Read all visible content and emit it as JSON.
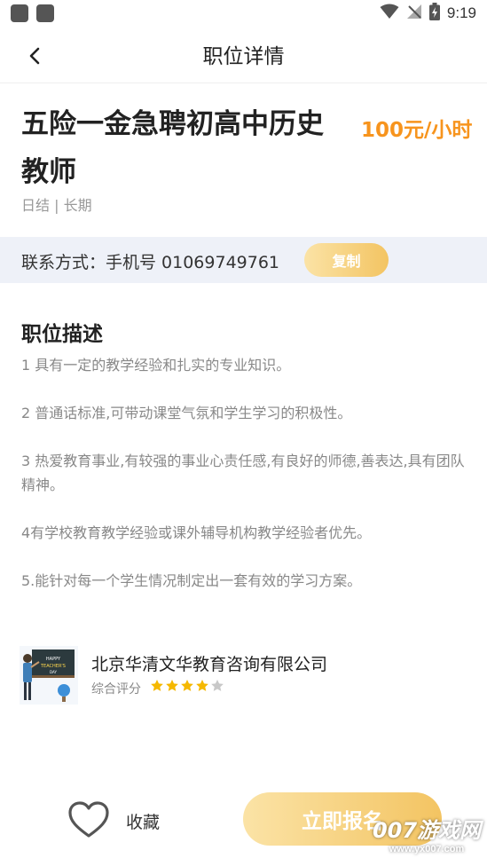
{
  "status_bar": {
    "time": "9:19",
    "icons": [
      "app-notification-icon",
      "app-notification-icon",
      "wifi-icon",
      "no-signal-icon",
      "battery-charging-icon"
    ]
  },
  "nav": {
    "title": "职位详情",
    "back_icon": "chevron-left-icon"
  },
  "job": {
    "title": "五险一金急聘初高中历史教师",
    "salary": "100元/小时",
    "tags": "日结 | 长期"
  },
  "contact": {
    "text": "联系方式：手机号 01069749761",
    "copy_label": "复制"
  },
  "description": {
    "heading": "职位描述",
    "items": [
      "1 具有一定的教学经验和扎实的专业知识。",
      "2 普通话标准,可带动课堂气氛和学生学习的积极性。",
      "3 热爱教育事业,有较强的事业心责任感,有良好的师德,善表达,具有团队精神。",
      "4有学校教育教学经验或课外辅导机构教学经验者优先。",
      "5.能针对每一个学生情况制定出一套有效的学习方案。"
    ]
  },
  "company": {
    "name": "北京华清文华教育咨询有限公司",
    "rating_label": "综合评分",
    "rating": 4,
    "rating_max": 5,
    "star_color": "#f5b800",
    "logo_icon": "teacher-classroom-logo",
    "logo_text": "HAPPY TEACHER'S DAY"
  },
  "bottom": {
    "favorite_label": "收藏",
    "apply_label": "立即报名"
  },
  "watermark": {
    "main": "007游戏网",
    "url": "www.yx007.com"
  },
  "colors": {
    "accent_orange": "#f7941d",
    "gold_gradient_start": "#fbe3a6",
    "gold_gradient_end": "#f3c462",
    "contact_band": "#eef1f8"
  }
}
